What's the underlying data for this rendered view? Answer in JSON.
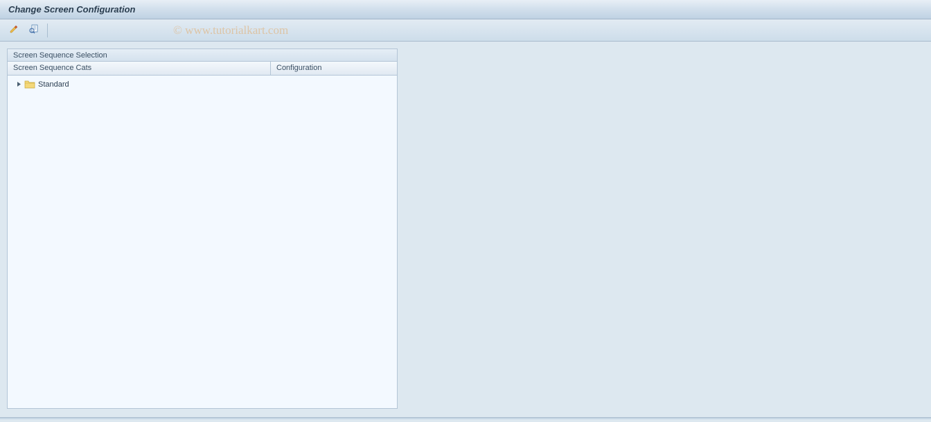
{
  "header": {
    "title": "Change Screen Configuration"
  },
  "watermark": "© www.tutorialkart.com",
  "panel": {
    "title": "Screen Sequence Selection",
    "columns": {
      "col1": "Screen Sequence Cats",
      "col2": "Configuration"
    },
    "tree": {
      "items": [
        {
          "label": "Standard",
          "expanded": false
        }
      ]
    }
  }
}
